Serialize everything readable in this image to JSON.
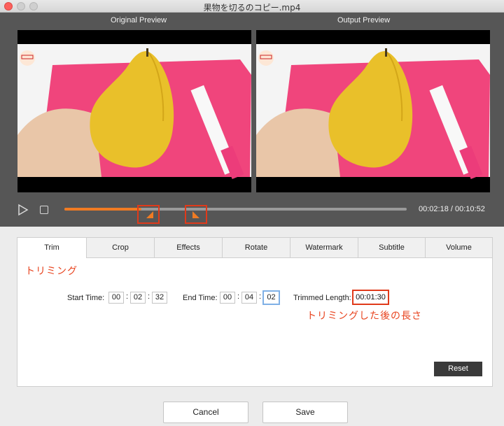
{
  "window": {
    "title": "果物を切るのコピー.mp4"
  },
  "preview": {
    "original_label": "Original Preview",
    "output_label": "Output  Preview"
  },
  "playback": {
    "timecode": "00:02:18 / 00:10:52",
    "progress": 0.225,
    "trim_start": 0.245,
    "trim_end": 0.385
  },
  "tabs": [
    {
      "label": "Trim",
      "active": true
    },
    {
      "label": "Crop"
    },
    {
      "label": "Effects"
    },
    {
      "label": "Rotate"
    },
    {
      "label": "Watermark"
    },
    {
      "label": "Subtitle"
    },
    {
      "label": "Volume"
    }
  ],
  "annotations": {
    "trimming": "トリミング",
    "trimmed_length_note": "トリミングした後の長さ"
  },
  "trim": {
    "start_label": "Start Time:",
    "start": {
      "h": "00",
      "m": "02",
      "s": "32"
    },
    "end_label": "End Time:",
    "end": {
      "h": "00",
      "m": "04",
      "s": "02"
    },
    "length_label": "Trimmed Length:",
    "length": "00:01:30",
    "reset_label": "Reset"
  },
  "footer": {
    "cancel_label": "Cancel",
    "save_label": "Save"
  },
  "colors": {
    "accent": "#f07b23",
    "highlight": "#e03a1a",
    "board": "#f0457c"
  }
}
